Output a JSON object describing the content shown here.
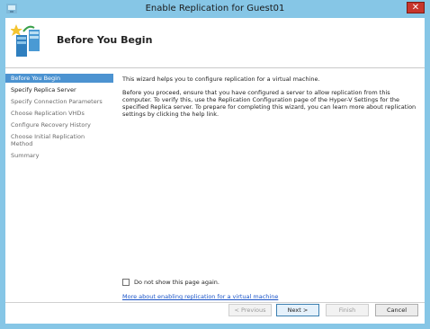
{
  "window": {
    "title": "Enable Replication for Guest01"
  },
  "header": {
    "title": "Before You Begin"
  },
  "nav": {
    "items": [
      {
        "label": "Before You Begin"
      },
      {
        "label": "Specify Replica Server"
      },
      {
        "label": "Specify Connection Parameters"
      },
      {
        "label": "Choose Replication VHDs"
      },
      {
        "label": "Configure Recovery History"
      },
      {
        "label": "Choose Initial Replication Method"
      },
      {
        "label": "Summary"
      }
    ]
  },
  "content": {
    "para1": "This wizard helps you to configure replication for a virtual machine.",
    "para2": "Before you proceed, ensure that you have configured a server to allow replication from this computer. To verify this, use the Replication Configuration page of the Hyper-V Settings for the specified Replica server. To prepare for completing this wizard, you can learn more about replication settings by clicking the help link.",
    "checkbox_label": "Do not show this page again.",
    "help_link": "More about enabling replication for a virtual machine"
  },
  "buttons": {
    "previous": "< Previous",
    "next": "Next >",
    "finish": "Finish",
    "cancel": "Cancel"
  }
}
